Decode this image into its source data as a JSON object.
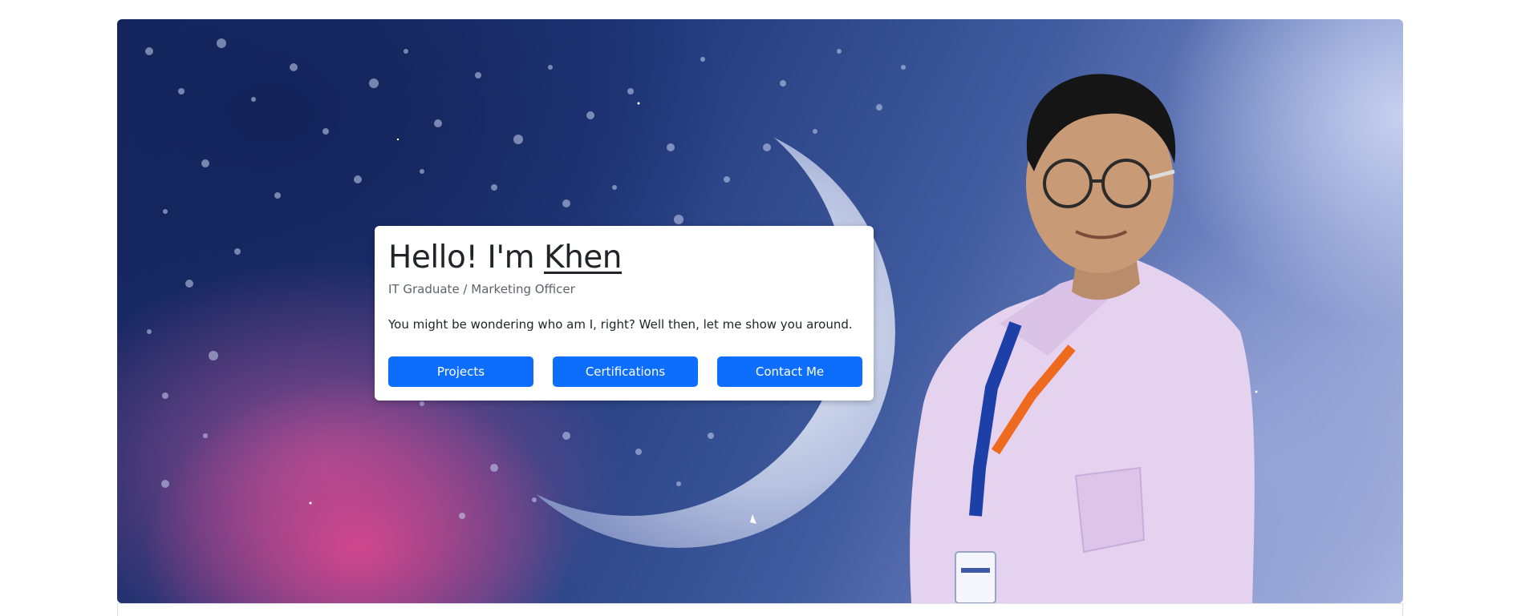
{
  "hero": {
    "greeting": "Hello! I'm ",
    "name": "Khen",
    "subtitle": "IT Graduate / Marketing Officer",
    "text": "You might be wondering who am I, right? Well then, let me show you around.",
    "buttons": [
      {
        "label": "Projects"
      },
      {
        "label": "Certifications"
      },
      {
        "label": "Contact Me"
      }
    ]
  },
  "colors": {
    "primary": "#0d6efd",
    "text": "#212529",
    "muted": "#5c636a"
  }
}
